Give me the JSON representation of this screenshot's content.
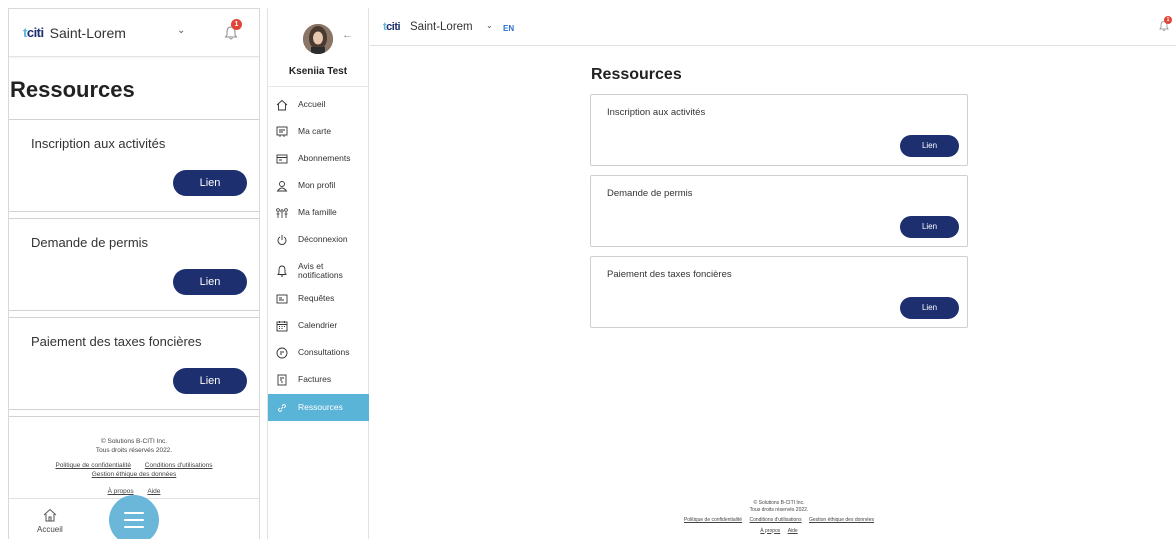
{
  "app": {
    "logo_prefix": "t",
    "logo_main": "citi",
    "city": "Saint-Lorem",
    "language": "EN",
    "notification_count": "1"
  },
  "mobile": {
    "page_title": "Ressources",
    "cards": [
      {
        "title": "Inscription aux activités",
        "button": "Lien"
      },
      {
        "title": "Demande de permis",
        "button": "Lien"
      },
      {
        "title": "Paiement des taxes foncières",
        "button": "Lien"
      }
    ],
    "footer": {
      "copyright": "© Solutions B-CITI Inc.",
      "rights": "Tous droits réservés 2022.",
      "privacy": "Politique de confidentialité",
      "terms": "Conditions d'utilisations",
      "ethics": "Gestion éthique des données",
      "about": "À propos",
      "help": "Aide"
    },
    "bottom_nav": {
      "home_label": "Accueil"
    }
  },
  "sidebar": {
    "user_name": "Kseniia Test",
    "items": [
      {
        "label": "Accueil",
        "icon": "home-icon"
      },
      {
        "label": "Ma carte",
        "icon": "card-icon"
      },
      {
        "label": "Abonnements",
        "icon": "subscriptions-icon"
      },
      {
        "label": "Mon profil",
        "icon": "user-icon"
      },
      {
        "label": "Ma famille",
        "icon": "family-icon"
      },
      {
        "label": "Déconnexion",
        "icon": "power-icon"
      },
      {
        "label": "Avis et notifications",
        "icon": "bell-icon"
      },
      {
        "label": "Requêtes",
        "icon": "requests-icon"
      },
      {
        "label": "Calendrier",
        "icon": "calendar-icon"
      },
      {
        "label": "Consultations",
        "icon": "consultations-icon"
      },
      {
        "label": "Factures",
        "icon": "invoice-icon"
      },
      {
        "label": "Ressources",
        "icon": "link-icon"
      }
    ],
    "active_item": "Ressources"
  },
  "desktop": {
    "page_title": "Ressources",
    "cards": [
      {
        "title": "Inscription aux activités",
        "button": "Lien"
      },
      {
        "title": "Demande de permis",
        "button": "Lien"
      },
      {
        "title": "Paiement des taxes foncières",
        "button": "Lien"
      }
    ],
    "footer": {
      "copyright": "© Solutions B-CITI Inc.",
      "rights": "Tous droits réservés 2022.",
      "privacy": "Politique de confidentialité",
      "terms": "Conditions d'utilisations",
      "ethics": "Gestion éthique des données",
      "about": "À propos",
      "help": "Aide"
    }
  },
  "colors": {
    "primary": "#1d2f6f",
    "accent": "#5ab4d8",
    "badge": "#e0453a"
  }
}
